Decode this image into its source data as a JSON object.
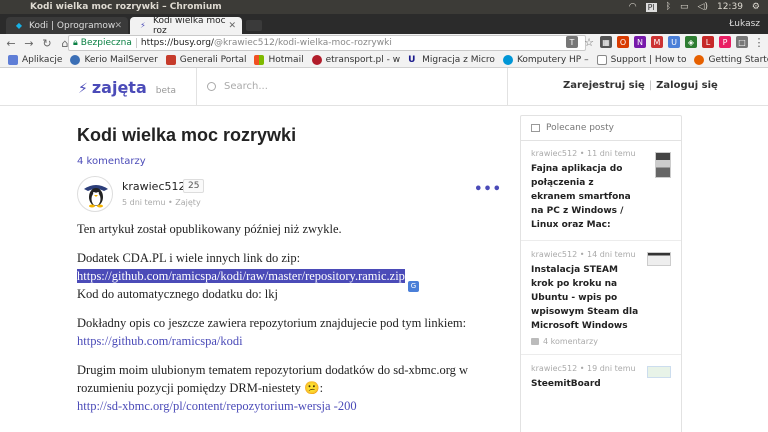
{
  "window": {
    "title": "Kodi wielka moc rozrywki – Chromium",
    "clock": "12:39",
    "user": "Łukasz"
  },
  "tabs": [
    {
      "label": "Kodi | Oprogramow",
      "active": false
    },
    {
      "label": "Kodi wielka moc roz",
      "active": true
    }
  ],
  "omnibox": {
    "secure_label": "Bezpieczna",
    "url_host": "https://busy.org/",
    "url_path": "@krawiec512/kodi-wielka-moc-rozrywki"
  },
  "bookmarks": [
    {
      "label": "Aplikacje",
      "color": "#5f7ed6"
    },
    {
      "label": "Kerio MailServer",
      "color": "#3b6fb6"
    },
    {
      "label": "Generali Portal",
      "color": "#c63b2b"
    },
    {
      "label": "Hotmail",
      "color": "#f25022"
    },
    {
      "label": "etransport.pl - w",
      "color": "#b11c2a"
    },
    {
      "label": "Migracja z Micro",
      "color": "#1a1a8c"
    },
    {
      "label": "Komputery HP –",
      "color": "#0096d6"
    },
    {
      "label": "Support | How to",
      "color": "#888888"
    },
    {
      "label": "Getting Started",
      "color": "#e66000"
    }
  ],
  "site": {
    "logo": "zajęta",
    "beta": "beta",
    "search_placeholder": "Search...",
    "register": "Zarejestruj się",
    "login": "Zaloguj się"
  },
  "article": {
    "title": "Kodi wielka moc rozrywki",
    "comments": "4 komentarzy",
    "author": "krawiec512",
    "reputation": "25",
    "time": "5 dni temu",
    "category": "Zajęty",
    "p1": "Ten artykuł został opublikowany później niż zwykle.",
    "p2_line1": "Dodatek CDA.PL i wiele innych link do zip:",
    "p2_link": "https://github.com/ramicspa/kodi/raw/master/repository.ramic.zip",
    "p2_line3": "Kod do automatycznego dodatku do: lkj",
    "p3_line1": "Dokładny opis co jeszcze zawiera repozytorium znajdujecie pod tym linkiem:",
    "p3_link": "https://github.com/ramicspa/kodi",
    "p4_line1": "Drugim moim ulubionym tematem repozytorium dodatków do sd-xbmc.org w rozumieniu pozycji pomiędzy DRM-niestety 😕:",
    "p4_link": "http://sd-xbmc.org/pl/content/repozytorium-wersja -200"
  },
  "sidebar": {
    "heading": "Polecane posty",
    "posts": [
      {
        "author": "krawiec512",
        "time": "11 dni temu",
        "title": "Fajna aplikacja do połączenia z ekranem smartfona na PC z Windows / Linux oraz Mac:",
        "comments": ""
      },
      {
        "author": "krawiec512",
        "time": "14 dni temu",
        "title": "Instalacja STEAM krok po kroku na Ubuntu - wpis po wpisowym Steam dla Microsoft Windows",
        "comments": "4 komentarzy"
      },
      {
        "author": "krawiec512",
        "time": "19 dni temu",
        "title": "SteemitBoard",
        "comments": ""
      }
    ]
  }
}
